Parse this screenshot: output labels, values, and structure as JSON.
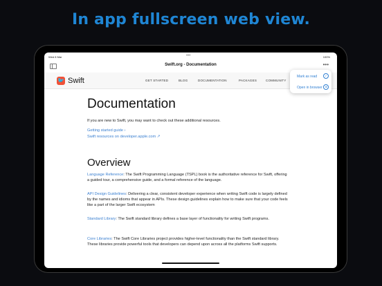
{
  "headline": "In app fullscreen web view.",
  "status_bar": {
    "time": "Wed 8 Mar",
    "center_dots": "•••",
    "right": "100%"
  },
  "nav_bar": {
    "title": "Swift.org - Documentation",
    "more": "•••"
  },
  "site": {
    "logo_text": "Swift",
    "nav": [
      "GET STARTED",
      "BLOG",
      "DOCUMENTATION",
      "PACKAGES",
      "COMMUNITY"
    ]
  },
  "menu": {
    "items": [
      "Mark as read",
      "Open in browser"
    ]
  },
  "page": {
    "title": "Documentation",
    "intro": "If you are new to Swift, you may want to check out these additional resources.",
    "links": [
      "Getting started guide ›",
      "Swift resources on developer.apple.com ↗"
    ],
    "overview_title": "Overview",
    "overview": [
      {
        "link": "Language Reference",
        "text": ": The Swift Programming Language (TSPL) book is the authoritative reference for Swift, offering a guided tour, a comprehensive guide, and a formal reference of the language."
      },
      {
        "link": "API Design Guidelines",
        "text": ": Delivering a clear, consistent developer experience when writing Swift code is largely defined by the names and idioms that appear in APIs. These design guidelines explain how to make sure that your code feels like a part of the larger Swift ecosystem"
      },
      {
        "link": "Standard Library",
        "text": ": The Swift standard library defines a base layer of functionality for writing Swift programs."
      },
      {
        "link": "Core Libraries",
        "text": ": The Swift Core Libraries project provides higher-level functionality than the Swift standard library. These libraries provide powerful tools that developers can depend upon across all the platforms Swift supports."
      }
    ]
  },
  "colors": {
    "headline": "#1f86d4",
    "link": "#3a7fd0",
    "swift_orange": "#f05138"
  }
}
